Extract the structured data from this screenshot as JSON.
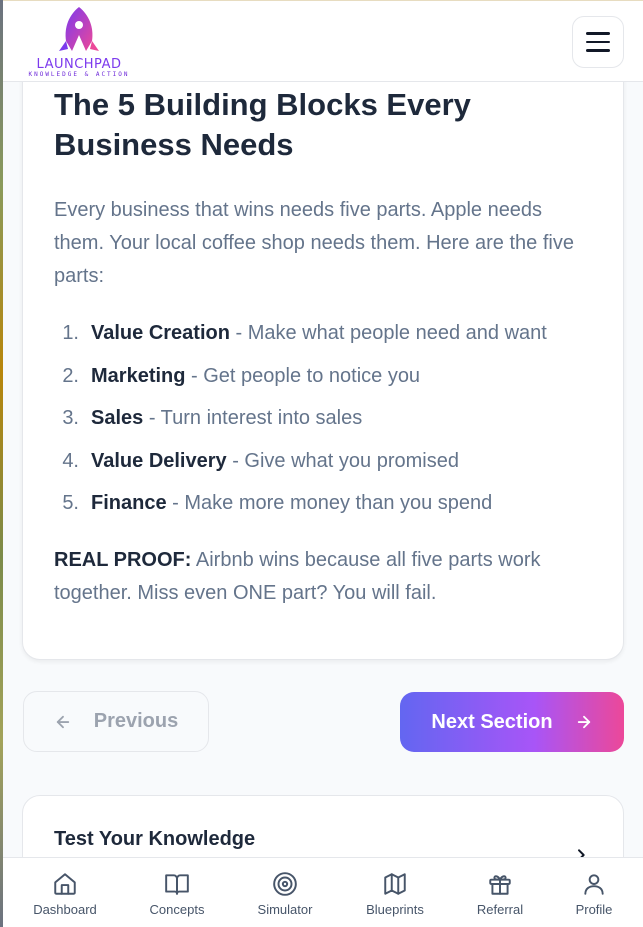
{
  "header": {
    "logo_title": "LAUNCHPAD",
    "logo_subtitle": "KNOWLEDGE & ACTION"
  },
  "lesson": {
    "title": "The 5 Building Blocks Every Business Needs",
    "intro": "Every business that wins needs five parts. Apple needs them. Your local coffee shop needs them. Here are the five parts:",
    "items": [
      {
        "num": "1.",
        "term": "Value Creation",
        "desc": " - Make what people need and want"
      },
      {
        "num": "2.",
        "term": "Marketing",
        "desc": " - Get people to notice you"
      },
      {
        "num": "3.",
        "term": "Sales",
        "desc": " - Turn interest into sales"
      },
      {
        "num": "4.",
        "term": "Value Delivery",
        "desc": " - Give what you promised"
      },
      {
        "num": "5.",
        "term": "Finance",
        "desc": " - Make more money than you spend"
      }
    ],
    "proof_label": "REAL PROOF:",
    "proof_text": " Airbnb wins because all five parts work together. Miss even ONE part? You will fail."
  },
  "navigation": {
    "previous_label": "Previous",
    "next_label": "Next Section"
  },
  "quiz": {
    "title": "Test Your Knowledge"
  },
  "bottom_nav": [
    {
      "label": "Dashboard",
      "icon": "home-icon"
    },
    {
      "label": "Concepts",
      "icon": "book-open-icon"
    },
    {
      "label": "Simulator",
      "icon": "target-icon"
    },
    {
      "label": "Blueprints",
      "icon": "map-icon"
    },
    {
      "label": "Referral",
      "icon": "gift-icon"
    },
    {
      "label": "Profile",
      "icon": "user-icon"
    }
  ],
  "colors": {
    "accent_gradient_start": "#6366f1",
    "accent_gradient_end": "#ec4899",
    "heading": "#1e293b",
    "body_text": "#64748b"
  }
}
